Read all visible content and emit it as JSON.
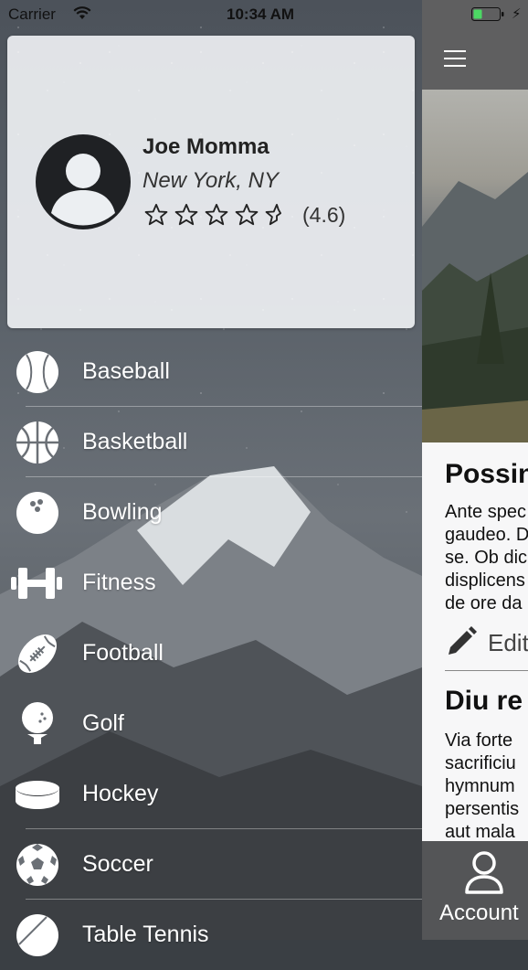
{
  "status_bar": {
    "carrier": "Carrier",
    "time": "10:34 AM"
  },
  "profile": {
    "name": "Joe Momma",
    "location": "New York, NY",
    "rating": 4.6,
    "rating_text": "(4.6)",
    "stars_max": 5
  },
  "menu": [
    {
      "label": "Baseball",
      "icon": "baseball-icon"
    },
    {
      "label": "Basketball",
      "icon": "basketball-icon"
    },
    {
      "label": "Bowling",
      "icon": "bowling-icon"
    },
    {
      "label": "Fitness",
      "icon": "dumbbell-icon"
    },
    {
      "label": "Football",
      "icon": "football-icon"
    },
    {
      "label": "Golf",
      "icon": "golf-icon"
    },
    {
      "label": "Hockey",
      "icon": "hockey-puck-icon"
    },
    {
      "label": "Soccer",
      "icon": "soccer-ball-icon"
    },
    {
      "label": "Table Tennis",
      "icon": "table-tennis-icon"
    }
  ],
  "main": {
    "section1_title": "Possin",
    "section1_lines": [
      "Ante spec",
      "gaudeo. D",
      "se. Ob dic",
      "displicens",
      "de ore da"
    ],
    "edit_label": "Edit",
    "section2_title": "Diu re",
    "section2_lines": [
      "Via forte",
      "sacrificiu",
      "hymnum",
      "persentis",
      "aut mala"
    ]
  },
  "tabbar": {
    "account_label": "Account"
  },
  "colors": {
    "drawer_text": "#ffffff",
    "topbar": "#5f5f60",
    "tabbar": "#545557",
    "card": "#eef0f3"
  }
}
